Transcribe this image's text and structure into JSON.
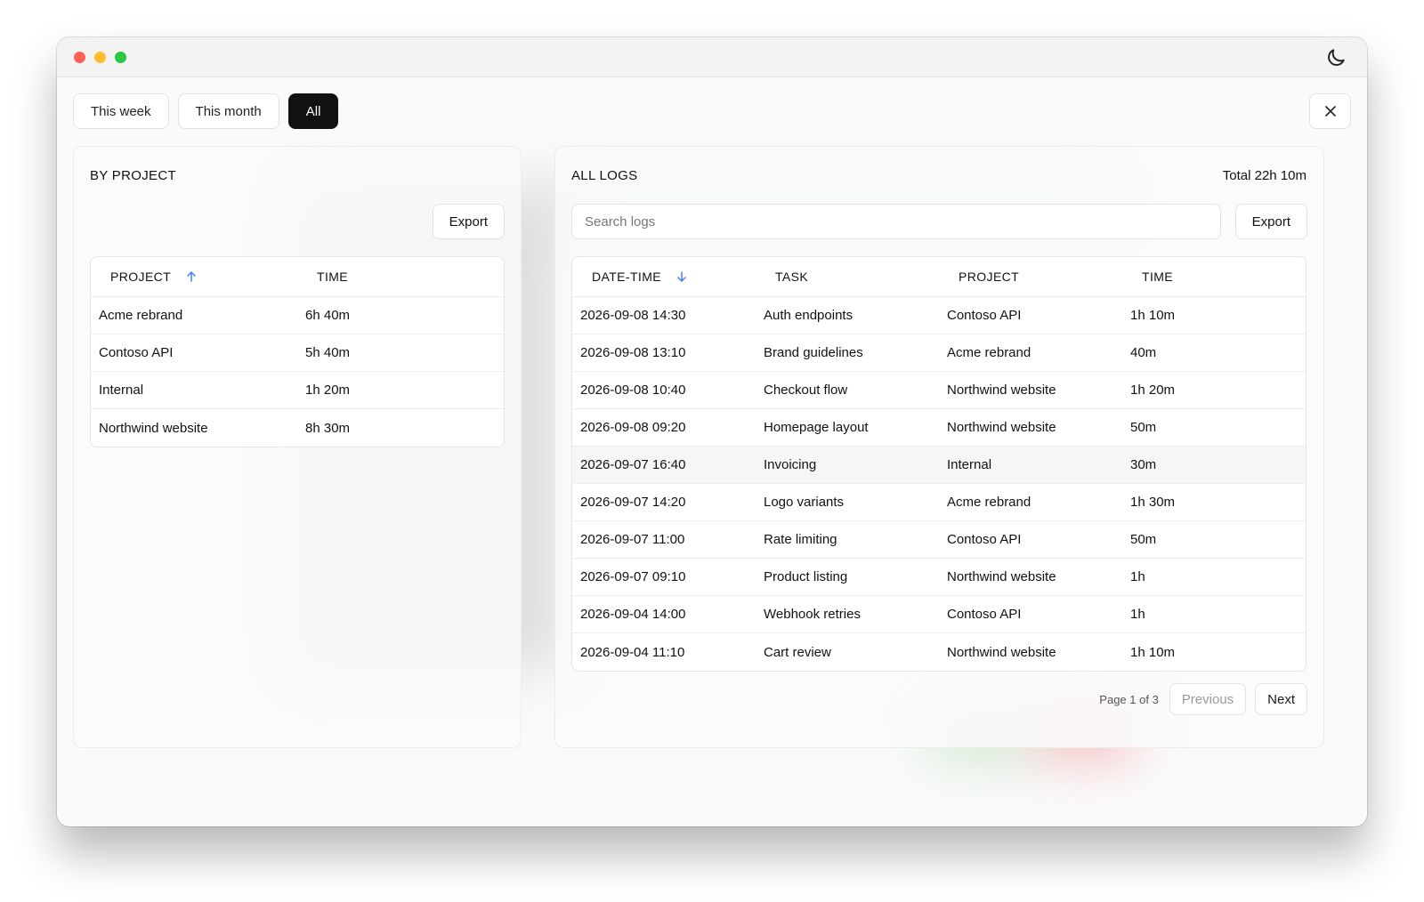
{
  "tabs": [
    {
      "label": "This week",
      "active": false
    },
    {
      "label": "This month",
      "active": false
    },
    {
      "label": "All",
      "active": true
    }
  ],
  "by_project": {
    "title": "BY PROJECT",
    "export_label": "Export",
    "columns": {
      "project": "PROJECT",
      "time": "TIME"
    },
    "sort": {
      "column": "project",
      "direction": "ascending"
    },
    "rows": [
      {
        "project": "Acme rebrand",
        "time": "6h 40m"
      },
      {
        "project": "Contoso API",
        "time": "5h 40m"
      },
      {
        "project": "Internal",
        "time": "1h 20m"
      },
      {
        "project": "Northwind website",
        "time": "8h 30m"
      }
    ]
  },
  "all_logs": {
    "title": "ALL LOGS",
    "total": "Total 22h 10m",
    "search": {
      "placeholder": "Search logs",
      "value": ""
    },
    "export_label": "Export",
    "columns": {
      "datetime": "DATE-TIME",
      "task": "TASK",
      "project": "PROJECT",
      "time": "TIME"
    },
    "sort": {
      "column": "datetime",
      "direction": "descending"
    },
    "rows": [
      {
        "datetime": "2026-09-08 14:30",
        "task": "Auth endpoints",
        "project": "Contoso API",
        "time": "1h 10m"
      },
      {
        "datetime": "2026-09-08 13:10",
        "task": "Brand guidelines",
        "project": "Acme rebrand",
        "time": "40m"
      },
      {
        "datetime": "2026-09-08 10:40",
        "task": "Checkout flow",
        "project": "Northwind website",
        "time": "1h 20m"
      },
      {
        "datetime": "2026-09-08 09:20",
        "task": "Homepage layout",
        "project": "Northwind website",
        "time": "50m"
      },
      {
        "datetime": "2026-09-07 16:40",
        "task": "Invoicing",
        "project": "Internal",
        "time": "30m",
        "highlighted": true
      },
      {
        "datetime": "2026-09-07 14:20",
        "task": "Logo variants",
        "project": "Acme rebrand",
        "time": "1h 30m"
      },
      {
        "datetime": "2026-09-07 11:00",
        "task": "Rate limiting",
        "project": "Contoso API",
        "time": "50m"
      },
      {
        "datetime": "2026-09-07 09:10",
        "task": "Product listing",
        "project": "Northwind website",
        "time": "1h"
      },
      {
        "datetime": "2026-09-04 14:00",
        "task": "Webhook retries",
        "project": "Contoso API",
        "time": "1h"
      },
      {
        "datetime": "2026-09-04 11:10",
        "task": "Cart review",
        "project": "Northwind website",
        "time": "1h 10m"
      }
    ],
    "pagination": {
      "info": "Page 1 of 3",
      "previous_label": "Previous",
      "previous_disabled": true,
      "next_label": "Next"
    }
  },
  "icons": {
    "theme_toggle": "moon-icon",
    "close": "close-icon",
    "sort_ascending": "arrow-up-icon",
    "sort_descending": "arrow-down-icon"
  },
  "colors": {
    "accent": "#3b82f6",
    "active_tab_bg": "#111111",
    "traffic_red": "#ff5f57",
    "traffic_yellow": "#febc2e",
    "traffic_green": "#28c840"
  }
}
